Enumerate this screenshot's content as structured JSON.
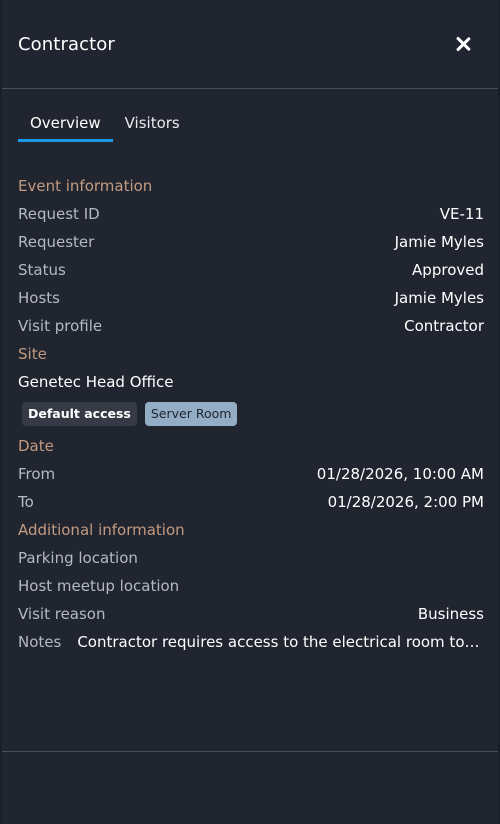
{
  "header": {
    "title": "Contractor"
  },
  "tabs": [
    {
      "label": "Overview",
      "active": true
    },
    {
      "label": "Visitors",
      "active": false
    }
  ],
  "event_info": {
    "title": "Event information",
    "rows": [
      {
        "label": "Request ID",
        "value": "VE-11"
      },
      {
        "label": "Requester",
        "value": "Jamie Myles"
      },
      {
        "label": "Status",
        "value": "Approved"
      },
      {
        "label": "Hosts",
        "value": "Jamie Myles"
      },
      {
        "label": "Visit profile",
        "value": "Contractor"
      }
    ]
  },
  "site": {
    "title": "Site",
    "name": "Genetec Head Office",
    "badges": [
      "Default access",
      "Server Room"
    ]
  },
  "date": {
    "title": "Date",
    "from_label": "From",
    "from_value": "01/28/2026, 10:00 AM",
    "to_label": "To",
    "to_value": "01/28/2026, 2:00 PM"
  },
  "additional": {
    "title": "Additional information",
    "parking_label": "Parking location",
    "parking_value": "",
    "meetup_label": "Host meetup location",
    "meetup_value": "",
    "reason_label": "Visit reason",
    "reason_value": "Business",
    "notes_label": "Notes",
    "notes_value": "Contractor requires access to the electrical room to perform maintenance"
  },
  "colors": {
    "background": "#202530",
    "section_title": "#c29a80",
    "tab_accent": "#1a9ae6",
    "badge_light": "#93aec4"
  },
  "icons": {
    "close": "close-icon"
  }
}
